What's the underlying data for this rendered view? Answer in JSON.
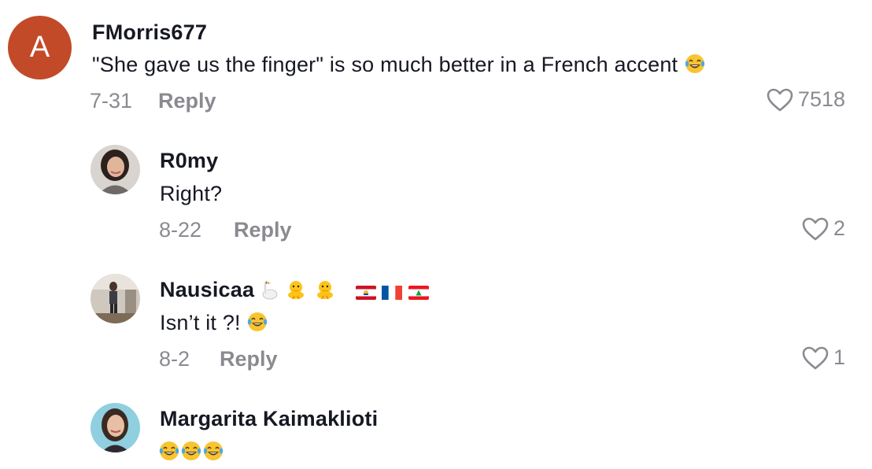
{
  "comments": [
    {
      "avatar_letter": "A",
      "avatar_color": "#c24a28",
      "username": "FMorris677",
      "text": "\"She gave us the finger\" is so much better in a French accent",
      "text_emoji": "laughing-tears-emoji",
      "date": "7-31",
      "reply_label": "Reply",
      "likes": "7518"
    },
    {
      "username": "R0my",
      "text": "Right?",
      "date": "8-22",
      "reply_label": "Reply",
      "likes": "2"
    },
    {
      "username": "Nausicaa",
      "username_emojis": [
        "goose-emoji",
        "hatching-chick-emoji",
        "hatching-chick-emoji",
        "french-polynesia-flag",
        "france-flag",
        "lebanon-flag"
      ],
      "text": "Isn’t it ?!",
      "text_emoji": "laughing-tears-emoji",
      "date": "8-2",
      "reply_label": "Reply",
      "likes": "1"
    },
    {
      "username": "Margarita Kaimaklioti",
      "text_emojis": [
        "laughing-tears-emoji",
        "laughing-tears-emoji",
        "laughing-tears-emoji"
      ]
    }
  ],
  "colors": {
    "text": "#161823",
    "secondary": "#8a8b91",
    "avatar_letter_bg": "#c24a28"
  }
}
